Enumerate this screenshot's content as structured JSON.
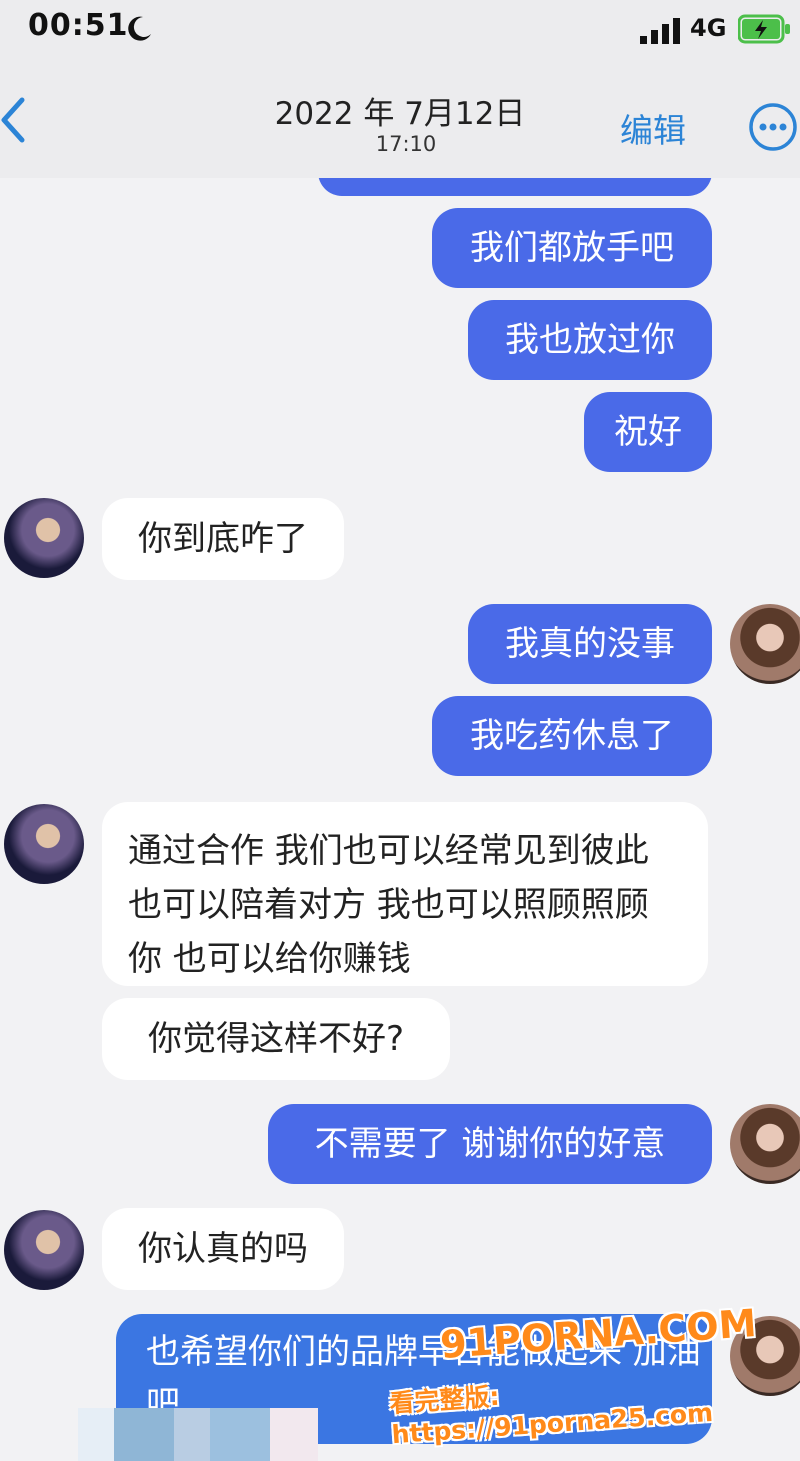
{
  "status": {
    "time": "00:51",
    "network": "4G"
  },
  "nav": {
    "date": "2022 年 7月12日",
    "time": "17:10",
    "edit_label": "编辑"
  },
  "messages": [
    {
      "from": "me",
      "text": "我们都放手吧"
    },
    {
      "from": "me",
      "text": "我也放过你"
    },
    {
      "from": "me",
      "text": "祝好"
    },
    {
      "from": "him",
      "text": "你到底咋了"
    },
    {
      "from": "me",
      "text": "我真的没事"
    },
    {
      "from": "me",
      "text": "我吃药休息了"
    },
    {
      "from": "him",
      "text": "通过合作 我们也可以经常见到彼此 也可以陪着对方 我也可以照顾照顾你 也可以给你赚钱"
    },
    {
      "from": "him",
      "text": "你觉得这样不好?"
    },
    {
      "from": "me",
      "text": "不需要了 谢谢你的好意"
    },
    {
      "from": "him",
      "text": "你认真的吗"
    },
    {
      "from": "me",
      "text": "也希望你们的品牌早日能做起来 加油吧"
    }
  ],
  "watermark": {
    "brand": "91PORNA.COM",
    "url_line": "看完整版: https://91porna25.com"
  },
  "colors": {
    "outgoing_bubble": "#4a6ae8",
    "incoming_bubble": "#ffffff",
    "accent": "#2c84d6"
  }
}
